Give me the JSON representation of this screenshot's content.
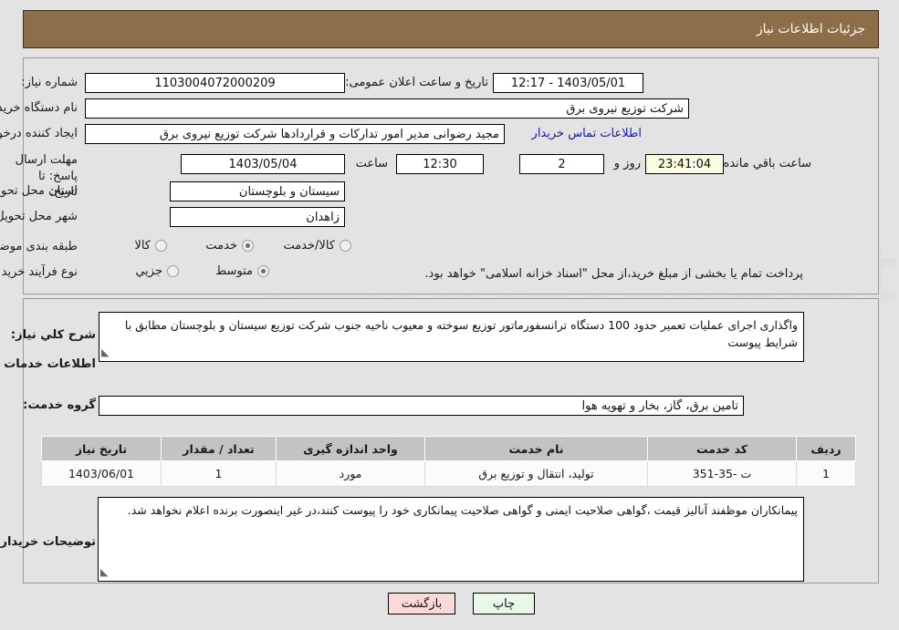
{
  "header": {
    "title": "جزئیات اطلاعات نیاز"
  },
  "form": {
    "need_number_label": "شماره نیاز:",
    "need_number_value": "1103004072000209",
    "public_announce_label": "تاریخ و ساعت اعلان عمومی:",
    "public_announce_value": "1403/05/01 - 12:17",
    "buyer_org_label": "نام دستگاه خریدار:",
    "buyer_org_value": "شرکت توزیع نیروی برق",
    "creator_label": "ایجاد کننده درخواست:",
    "creator_value": "مجید  رضوانی مدیر امور تدارکات و قراردادها شرکت توزیع نیروی برق",
    "contact_link": "اطلاعات تماس خریدار",
    "deadline_label": "مهلت ارسال پاسخ: تا تاریخ:",
    "deadline_date": "1403/05/04",
    "deadline_time_label": "ساعت",
    "deadline_time": "12:30",
    "days_value": "2",
    "days_label": "روز و",
    "countdown_value": "23:41:04",
    "countdown_label": "ساعت باقي مانده",
    "province_label": "استان محل تحویل:",
    "province_value": "سیستان و بلوچستان",
    "city_label": "شهر محل تحویل:",
    "city_value": "زاهدان",
    "category_label": "طبقه بندی موضوعی:",
    "category_options": [
      {
        "label": "کالا",
        "selected": false
      },
      {
        "label": "خدمت",
        "selected": true
      },
      {
        "label": "کالا/خدمت",
        "selected": false
      }
    ],
    "process_label": "نوع فرآیند خرید :",
    "process_options": [
      {
        "label": "جزیي",
        "selected": false
      },
      {
        "label": "متوسط",
        "selected": true
      }
    ],
    "process_note": "پرداخت تمام یا بخشی از مبلغ خرید،از محل \"اسناد خزانه اسلامی\" خواهد بود."
  },
  "description": {
    "general_label": "شرح کلي نیاز:",
    "general_value": "واگذاری اجرای عملیات تعمیر حدود 100 دستگاه ترانسفورماتور توزیع سوخته و معیوب ناحیه جنوب شرکت توزیع سیستان و بلوچستان مطابق با شرایط پیوست",
    "services_heading": "اطلاعات خدمات مورد نیاز",
    "service_group_label": "گروه خدمت:",
    "service_group_value": "تامین برق، گاز، بخار و تهویه هوا",
    "buyer_notes_label": "توضیحات خریدار:",
    "buyer_notes_value": "پیمانکاران موظفند آنالیز قیمت ،گواهی صلاحیت ایمنی و گواهی صلاحیت پیمانکاری خود را پیوست کنند،در غیر اینصورت برنده اعلام نخواهد شد."
  },
  "table": {
    "columns": [
      "ردیف",
      "کد خدمت",
      "نام خدمت",
      "واحد اندازه گیری",
      "تعداد / مقدار",
      "تاریخ نیاز"
    ],
    "rows": [
      {
        "row_no": "1",
        "service_code": "ت -35-351",
        "service_name": "تولید، انتقال و توزیع برق",
        "unit": "مورد",
        "quantity": "1",
        "need_date": "1403/06/01"
      }
    ]
  },
  "buttons": {
    "print": "چاپ",
    "back": "بازگشت"
  },
  "colors": {
    "header_bg": "#8d6e4b",
    "page_bg": "#e3e3e3",
    "link": "#1414d2",
    "timer_bg": "#fbfbe2",
    "print_bg": "#e8f7e8",
    "back_bg": "#fbd9d9",
    "table_header_bg": "#c3c3c3"
  }
}
